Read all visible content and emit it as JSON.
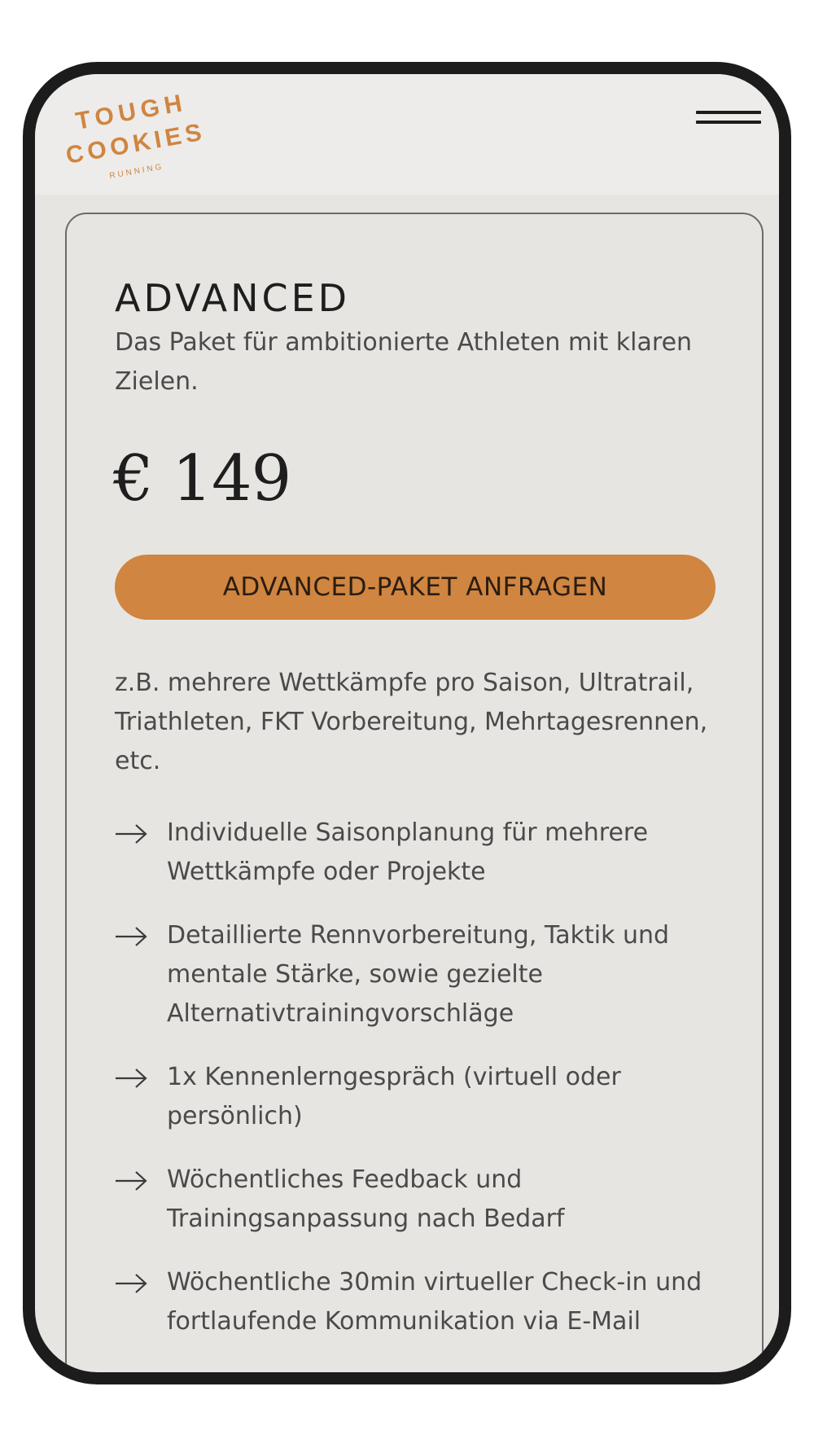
{
  "header": {
    "logo": {
      "line1": "TOUGH",
      "line2": "COOKIES",
      "line3": "RUNNING"
    },
    "menu_icon": "hamburger-icon"
  },
  "plan": {
    "title": "ADVANCED",
    "description": "Das Paket für ambitionierte Athleten mit klaren Zielen.",
    "price": "€ 149",
    "cta_label": "ADVANCED-PAKET ANFRAGEN",
    "examples": "z.B. mehrere Wettkämpfe pro Saison, Ultratrail, Triathleten, FKT Vorbereitung, Mehrtagesrennen, etc.",
    "features": [
      "Individuelle Saisonplanung für mehrere Wettkämpfe oder Projekte",
      "Detaillierte Rennvorbereitung, Taktik und mentale Stärke, sowie gezielte Alternativtrainingvorschläge",
      "1x Kennenlerngespräch (virtuell oder persönlich)",
      "Wöchentliches Feedback und Trainingsanpassung nach Bedarf",
      "Wöchentliche 30min virtueller Check-in und fortlaufende Kommunikation via E-Mail"
    ]
  },
  "colors": {
    "accent": "#d08540",
    "background": "#e7e5e2",
    "frame": "#1c1c1c",
    "text": "#4a4a4a"
  }
}
